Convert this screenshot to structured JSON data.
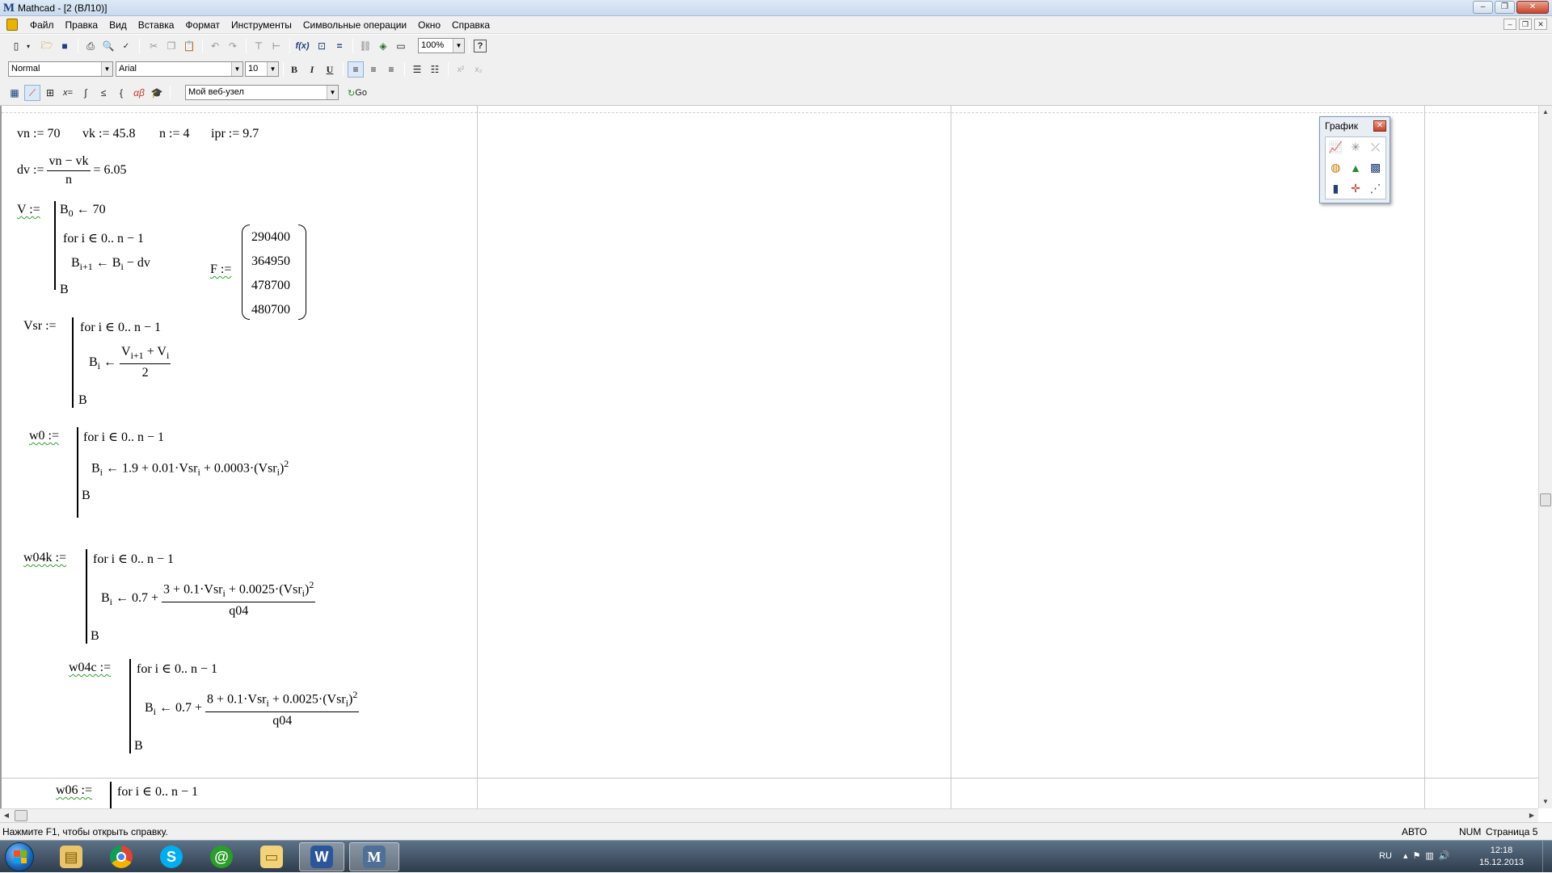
{
  "window": {
    "title": "Mathcad - [2 (ВЛ10)]",
    "controls": {
      "minimize": "–",
      "restore": "❐",
      "close": "✕"
    }
  },
  "menu": {
    "items": [
      "Файл",
      "Правка",
      "Вид",
      "Вставка",
      "Формат",
      "Инструменты",
      "Символьные операции",
      "Окно",
      "Справка"
    ]
  },
  "toolbar": {
    "zoom": "100%",
    "style": "Normal",
    "font": "Arial",
    "font_size": "10",
    "bold": "B",
    "italic": "I",
    "underline": "U",
    "web_address": "Мой веб-узел",
    "go_label": "Go"
  },
  "worksheet": {
    "line1": {
      "vn": "vn := 70",
      "vk": "vk := 45.8",
      "n": "n := 4",
      "ipr": "ipr := 9.7"
    },
    "dv": {
      "lhs": "dv :=",
      "num": "vn − vk",
      "den": "n",
      "result": "= 6.05"
    },
    "V": {
      "lhs": "V :=",
      "line1_base": "B",
      "line1_sub": "0",
      "line1_rest": " ← 70",
      "line2": "for  i ∈ 0.. n − 1",
      "line3_a": "B",
      "line3_a_sub": "i+1",
      "line3_b": " ← B",
      "line3_b_sub": "i",
      "line3_c": " − dv",
      "line4": "B"
    },
    "F": {
      "lhs": "F :=",
      "values": [
        "290400",
        "364950",
        "478700",
        "480700"
      ]
    },
    "Vsr": {
      "lhs": "Vsr :=",
      "line1": "for  i ∈ 0.. n − 1",
      "assign_base": "B",
      "assign_sub": "i",
      "arrow": " ← ",
      "num_a": "V",
      "num_a_sub": "i+1",
      "num_b": " + V",
      "num_b_sub": "i",
      "den": "2",
      "line3": "B"
    },
    "w0": {
      "lhs": "w0 :=",
      "line1": "for  i ∈ 0.. n − 1",
      "assign_base": "B",
      "assign_sub": "i",
      "expr": " ← 1.9 + 0.01·Vsr",
      "expr_sub": "i",
      "expr2": " + 0.0003·(Vsr",
      "expr2_sub": "i",
      "expr3": ")",
      "expr_sup": "2",
      "line3": "B"
    },
    "w04k": {
      "lhs": "w04k :=",
      "line1": "for  i ∈ 0.. n − 1",
      "assign_base": "B",
      "assign_sub": "i",
      "prefix": " ← 0.7 + ",
      "num": "3 + 0.1·Vsr",
      "num_sub": "i",
      "num2": " + 0.0025·(Vsr",
      "num2_sub": "i",
      "num3": ")",
      "num_sup": "2",
      "den": "q04",
      "line3": "B"
    },
    "w04c": {
      "lhs": "w04c :=",
      "line1": "for  i ∈ 0.. n − 1",
      "assign_base": "B",
      "assign_sub": "i",
      "prefix": " ← 0.7 + ",
      "num": "8 + 0.1·Vsr",
      "num_sub": "i",
      "num2": " + 0.0025·(Vsr",
      "num2_sub": "i",
      "num3": ")",
      "num_sup": "2",
      "den": "q04",
      "line3": "B"
    },
    "w06": {
      "lhs": "w06 :=",
      "line1": "for  i ∈ 0.. n − 1"
    }
  },
  "graph_palette": {
    "title": "График",
    "close": "✕",
    "icons": [
      "xy-plot-icon",
      "polar-plot-icon",
      "3d-curve-icon",
      "surface-plot-icon",
      "contour-plot-icon",
      "scatter-3d-icon",
      "bar-3d-icon",
      "vector-field-icon",
      "3d-plot-wizard-icon"
    ]
  },
  "status": {
    "hint": "Нажмите F1, чтобы открыть справку.",
    "mode": "АВТО",
    "num": "NUM",
    "page": "Страница 5"
  },
  "taskbar": {
    "lang": "RU",
    "time": "12:18",
    "date": "15.12.2013",
    "apps": [
      "explorer-icon",
      "chrome-icon",
      "skype-icon",
      "mail-agent-icon",
      "folder-icon",
      "word-icon",
      "mathcad-icon"
    ]
  },
  "colors": {
    "accent": "#1d3f7a",
    "wavy_underline": "#2e9e2e",
    "taskbar": "#3a4b5e"
  }
}
